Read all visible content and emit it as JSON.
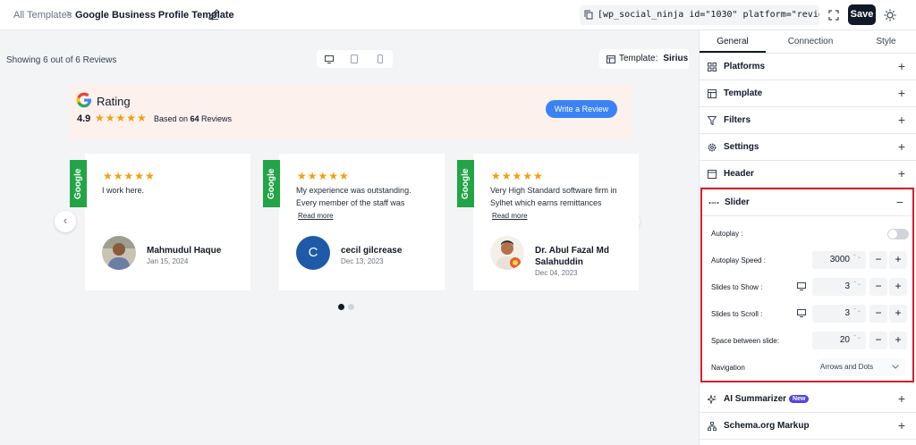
{
  "header": {
    "breadcrumb_root": "All Templates",
    "breadcrumb_sep": ">",
    "title": "Google Business Profile Template",
    "shortcode": "[wp_social_ninja id=\"1030\" platform=\"reviews\"]",
    "save_label": "Save",
    "icons": [
      "edit-icon",
      "copy-icon",
      "fullscreen-icon",
      "sun-icon"
    ]
  },
  "toolbar": {
    "showing": "Showing 6 out of 6 Reviews",
    "devices": [
      "desktop-icon",
      "tablet-icon",
      "mobile-icon"
    ],
    "template_label": "Template:",
    "template_value": "Sirius"
  },
  "rating": {
    "title": "Rating",
    "score": "4.9",
    "stars": "★★★★★",
    "based_prefix": "Based on ",
    "count": "64",
    "based_suffix": " Reviews",
    "button": "Write a Review"
  },
  "reviews": [
    {
      "source": "Google",
      "stars": "★★★★★",
      "text": "I work here.",
      "read_more": "",
      "name": "Mahmudul Haque",
      "date": "Jan 15, 2024",
      "avatar": "photo"
    },
    {
      "source": "Google",
      "stars": "★★★★★",
      "text": "My experience was outstanding. Every member of the staff was",
      "read_more": "Read more",
      "name": "cecil gilcrease",
      "date": "Dec 13, 2023",
      "avatar_letter": "C"
    },
    {
      "source": "Google",
      "stars": "★★★★★",
      "text": "Very High Standard software firm in Sylhet which earns remittances",
      "read_more": "Read more",
      "name": "Dr. Abul Fazal Md Salahuddin",
      "date": "Dec 04, 2023",
      "avatar": "photo"
    }
  ],
  "carousel": {
    "prev": "‹",
    "next": "›",
    "dots": 2,
    "active_dot": 0
  },
  "panel": {
    "tabs": [
      "General",
      "Connection",
      "Style"
    ],
    "active_tab": "General",
    "sections": [
      {
        "label": "Platforms",
        "icon": "grid-icon",
        "toggle": "+"
      },
      {
        "label": "Template",
        "icon": "layout-icon",
        "toggle": "+"
      },
      {
        "label": "Filters",
        "icon": "filter-icon",
        "toggle": "+"
      },
      {
        "label": "Settings",
        "icon": "gear-icon",
        "toggle": "+"
      },
      {
        "label": "Header",
        "icon": "header-icon",
        "toggle": "+"
      }
    ],
    "slider": {
      "label": "Slider",
      "toggle": "−",
      "autoplay_label": "Autoplay :",
      "autoplay_on": false,
      "speed_label": "Autoplay Speed :",
      "speed_value": "3000",
      "show_label": "Slides to Show :",
      "show_value": "3",
      "scroll_label": "Slides to Scroll :",
      "scroll_value": "3",
      "space_label": "Space between slide:",
      "space_value": "20",
      "nav_label": "Navigation",
      "nav_value": "Arrows and Dots",
      "minus": "−",
      "plus": "+",
      "spin": "⌃⌄"
    },
    "bottom_sections": [
      {
        "label": "AI Summarizer",
        "badge": "New",
        "icon": "sparkle-icon",
        "toggle": "+"
      },
      {
        "label": "Schema.org Markup",
        "icon": "sitemap-icon",
        "toggle": "+"
      }
    ]
  },
  "colors": {
    "accent": "#3b82f6",
    "google_green": "#22a447",
    "highlight": "#d81e2a",
    "star": "#f59e0b"
  }
}
